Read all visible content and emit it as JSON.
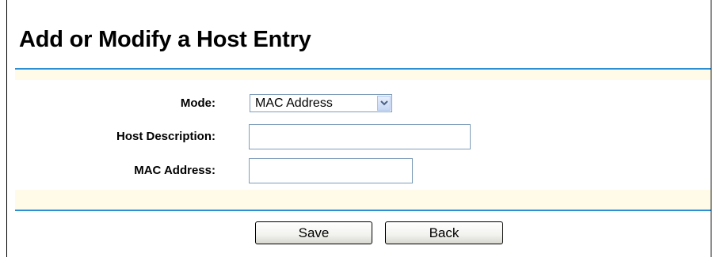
{
  "page": {
    "title": "Add or Modify a Host Entry"
  },
  "form": {
    "mode": {
      "label": "Mode:",
      "selected": "MAC Address"
    },
    "host_description": {
      "label": "Host Description:",
      "value": ""
    },
    "mac_address": {
      "label": "MAC Address:",
      "value": ""
    }
  },
  "buttons": {
    "save_label": "Save",
    "back_label": "Back"
  },
  "colors": {
    "rule_blue": "#2a8fd5",
    "band_cream": "#fffbe8"
  },
  "icons": {
    "select_arrow": "chevron-down-icon"
  }
}
